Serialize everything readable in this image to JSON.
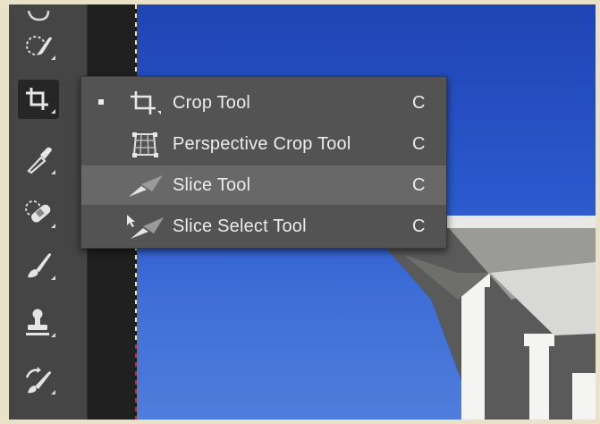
{
  "flyout": {
    "items": [
      {
        "label": "Crop Tool",
        "shortcut": "C",
        "icon": "crop-icon",
        "selected": true
      },
      {
        "label": "Perspective Crop Tool",
        "shortcut": "C",
        "icon": "perspective-crop-icon",
        "selected": false
      },
      {
        "label": "Slice Tool",
        "shortcut": "C",
        "icon": "slice-icon",
        "selected": false
      },
      {
        "label": "Slice Select Tool",
        "shortcut": "C",
        "icon": "slice-select-icon",
        "selected": false
      }
    ]
  },
  "toolbar": {
    "tools": [
      "lasso-icon",
      "quick-selection-icon",
      "crop-icon",
      "eyedropper-icon",
      "spot-healing-icon",
      "brush-icon",
      "clone-stamp-icon",
      "history-brush-icon"
    ]
  },
  "colors": {
    "sky": "#2a58cc",
    "highlight": "#686868",
    "panel": "#535353"
  }
}
